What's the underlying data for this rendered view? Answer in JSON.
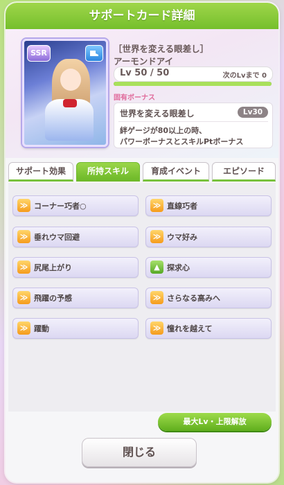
{
  "title": "サポートカード詳細",
  "card": {
    "rarity": "SSR",
    "type_icon": "shoe-icon",
    "title": "［世界を変える眼差し］",
    "name": "アーモンドアイ",
    "level": "Lv 50 / 50",
    "next_level": "次のLvまで 0",
    "level_progress": 1.0
  },
  "unique_bonus": {
    "heading": "固有ボーナス",
    "name": "世界を変える眼差し",
    "level": "Lv30",
    "desc_line1": "絆ゲージが80以上の時、",
    "desc_line2": "パワーボーナスとスキルPtボーナス"
  },
  "tabs": [
    {
      "label": "サポート効果",
      "active": false
    },
    {
      "label": "所持スキル",
      "active": true
    },
    {
      "label": "育成イベント",
      "active": false
    },
    {
      "label": "エピソード",
      "active": false
    }
  ],
  "skills": [
    {
      "label": "コーナー巧者○",
      "icon": "orange"
    },
    {
      "label": "直線巧者",
      "icon": "orange"
    },
    {
      "label": "垂れウマ回避",
      "icon": "orange"
    },
    {
      "label": "ウマ好み",
      "icon": "orange"
    },
    {
      "label": "尻尾上がり",
      "icon": "orange"
    },
    {
      "label": "探求心",
      "icon": "green"
    },
    {
      "label": "飛躍の予感",
      "icon": "orange"
    },
    {
      "label": "さらなる高みへ",
      "icon": "orange"
    },
    {
      "label": "躍動",
      "icon": "orange"
    },
    {
      "label": "憧れを越えて",
      "icon": "orange"
    }
  ],
  "buttons": {
    "max_level": "最大Lv・上限解放",
    "close": "閉じる"
  },
  "colors": {
    "accent_green": "#78c23c",
    "bonus_heading": "#e06b9b"
  }
}
